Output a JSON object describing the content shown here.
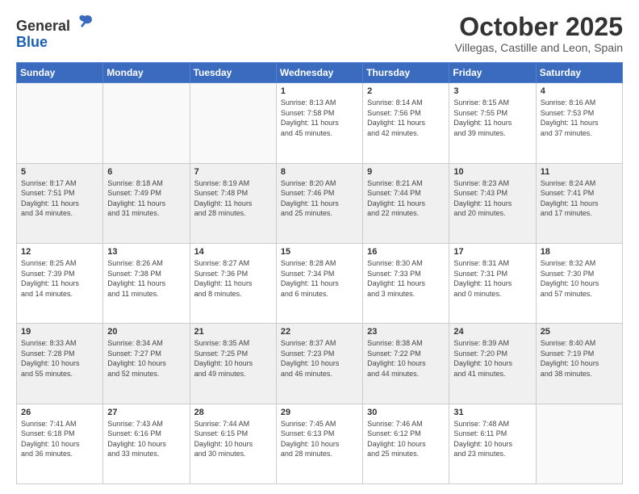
{
  "logo": {
    "line1": "General",
    "line2": "Blue"
  },
  "header": {
    "month": "October 2025",
    "location": "Villegas, Castille and Leon, Spain"
  },
  "weekdays": [
    "Sunday",
    "Monday",
    "Tuesday",
    "Wednesday",
    "Thursday",
    "Friday",
    "Saturday"
  ],
  "weeks": [
    [
      {
        "day": "",
        "info": ""
      },
      {
        "day": "",
        "info": ""
      },
      {
        "day": "",
        "info": ""
      },
      {
        "day": "1",
        "info": "Sunrise: 8:13 AM\nSunset: 7:58 PM\nDaylight: 11 hours\nand 45 minutes."
      },
      {
        "day": "2",
        "info": "Sunrise: 8:14 AM\nSunset: 7:56 PM\nDaylight: 11 hours\nand 42 minutes."
      },
      {
        "day": "3",
        "info": "Sunrise: 8:15 AM\nSunset: 7:55 PM\nDaylight: 11 hours\nand 39 minutes."
      },
      {
        "day": "4",
        "info": "Sunrise: 8:16 AM\nSunset: 7:53 PM\nDaylight: 11 hours\nand 37 minutes."
      }
    ],
    [
      {
        "day": "5",
        "info": "Sunrise: 8:17 AM\nSunset: 7:51 PM\nDaylight: 11 hours\nand 34 minutes."
      },
      {
        "day": "6",
        "info": "Sunrise: 8:18 AM\nSunset: 7:49 PM\nDaylight: 11 hours\nand 31 minutes."
      },
      {
        "day": "7",
        "info": "Sunrise: 8:19 AM\nSunset: 7:48 PM\nDaylight: 11 hours\nand 28 minutes."
      },
      {
        "day": "8",
        "info": "Sunrise: 8:20 AM\nSunset: 7:46 PM\nDaylight: 11 hours\nand 25 minutes."
      },
      {
        "day": "9",
        "info": "Sunrise: 8:21 AM\nSunset: 7:44 PM\nDaylight: 11 hours\nand 22 minutes."
      },
      {
        "day": "10",
        "info": "Sunrise: 8:23 AM\nSunset: 7:43 PM\nDaylight: 11 hours\nand 20 minutes."
      },
      {
        "day": "11",
        "info": "Sunrise: 8:24 AM\nSunset: 7:41 PM\nDaylight: 11 hours\nand 17 minutes."
      }
    ],
    [
      {
        "day": "12",
        "info": "Sunrise: 8:25 AM\nSunset: 7:39 PM\nDaylight: 11 hours\nand 14 minutes."
      },
      {
        "day": "13",
        "info": "Sunrise: 8:26 AM\nSunset: 7:38 PM\nDaylight: 11 hours\nand 11 minutes."
      },
      {
        "day": "14",
        "info": "Sunrise: 8:27 AM\nSunset: 7:36 PM\nDaylight: 11 hours\nand 8 minutes."
      },
      {
        "day": "15",
        "info": "Sunrise: 8:28 AM\nSunset: 7:34 PM\nDaylight: 11 hours\nand 6 minutes."
      },
      {
        "day": "16",
        "info": "Sunrise: 8:30 AM\nSunset: 7:33 PM\nDaylight: 11 hours\nand 3 minutes."
      },
      {
        "day": "17",
        "info": "Sunrise: 8:31 AM\nSunset: 7:31 PM\nDaylight: 11 hours\nand 0 minutes."
      },
      {
        "day": "18",
        "info": "Sunrise: 8:32 AM\nSunset: 7:30 PM\nDaylight: 10 hours\nand 57 minutes."
      }
    ],
    [
      {
        "day": "19",
        "info": "Sunrise: 8:33 AM\nSunset: 7:28 PM\nDaylight: 10 hours\nand 55 minutes."
      },
      {
        "day": "20",
        "info": "Sunrise: 8:34 AM\nSunset: 7:27 PM\nDaylight: 10 hours\nand 52 minutes."
      },
      {
        "day": "21",
        "info": "Sunrise: 8:35 AM\nSunset: 7:25 PM\nDaylight: 10 hours\nand 49 minutes."
      },
      {
        "day": "22",
        "info": "Sunrise: 8:37 AM\nSunset: 7:23 PM\nDaylight: 10 hours\nand 46 minutes."
      },
      {
        "day": "23",
        "info": "Sunrise: 8:38 AM\nSunset: 7:22 PM\nDaylight: 10 hours\nand 44 minutes."
      },
      {
        "day": "24",
        "info": "Sunrise: 8:39 AM\nSunset: 7:20 PM\nDaylight: 10 hours\nand 41 minutes."
      },
      {
        "day": "25",
        "info": "Sunrise: 8:40 AM\nSunset: 7:19 PM\nDaylight: 10 hours\nand 38 minutes."
      }
    ],
    [
      {
        "day": "26",
        "info": "Sunrise: 7:41 AM\nSunset: 6:18 PM\nDaylight: 10 hours\nand 36 minutes."
      },
      {
        "day": "27",
        "info": "Sunrise: 7:43 AM\nSunset: 6:16 PM\nDaylight: 10 hours\nand 33 minutes."
      },
      {
        "day": "28",
        "info": "Sunrise: 7:44 AM\nSunset: 6:15 PM\nDaylight: 10 hours\nand 30 minutes."
      },
      {
        "day": "29",
        "info": "Sunrise: 7:45 AM\nSunset: 6:13 PM\nDaylight: 10 hours\nand 28 minutes."
      },
      {
        "day": "30",
        "info": "Sunrise: 7:46 AM\nSunset: 6:12 PM\nDaylight: 10 hours\nand 25 minutes."
      },
      {
        "day": "31",
        "info": "Sunrise: 7:48 AM\nSunset: 6:11 PM\nDaylight: 10 hours\nand 23 minutes."
      },
      {
        "day": "",
        "info": ""
      }
    ]
  ]
}
